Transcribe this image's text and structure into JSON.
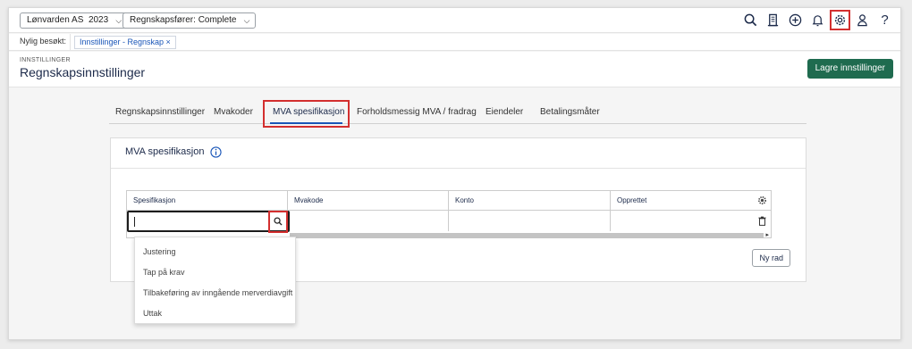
{
  "topbar": {
    "company": "Lønvarden AS",
    "year": "2023",
    "accountant": "Regnskapsfører: Complete",
    "icons": [
      "search-icon",
      "building-icon",
      "plus-circle-icon",
      "bell-icon",
      "gear-icon",
      "user-icon",
      "help-icon"
    ],
    "help_glyph": "?"
  },
  "recent": {
    "label": "Nylig besøkt:",
    "tab": "Innstillinger - Regnskap ×"
  },
  "header": {
    "breadcrumb": "INNSTILLINGER",
    "title": "Regnskapsinnstillinger",
    "save_label": "Lagre innstillinger"
  },
  "nav": {
    "tabs": [
      "Regnskapsinnstillinger",
      "Mvakoder",
      "MVA spesifikasjon",
      "Forholdsmessig MVA / fradrag",
      "Eiendeler",
      "Betalingsmåter"
    ],
    "active_index": 2
  },
  "card": {
    "title": "MVA spesifikasjon",
    "columns": [
      "Spesifikasjon",
      "Mvakode",
      "Konto",
      "Opprettet"
    ],
    "input_value": "",
    "new_row_label": "Ny rad",
    "dropdown": [
      "Justering",
      "Tap på krav",
      "Tilbakeføring av inngående merverdiavgift",
      "Uttak"
    ]
  },
  "colors": {
    "accent": "#1a56b8",
    "primary_button": "#1f6b4f",
    "highlight": "#d32f2f",
    "title": "#1c2a4a"
  }
}
